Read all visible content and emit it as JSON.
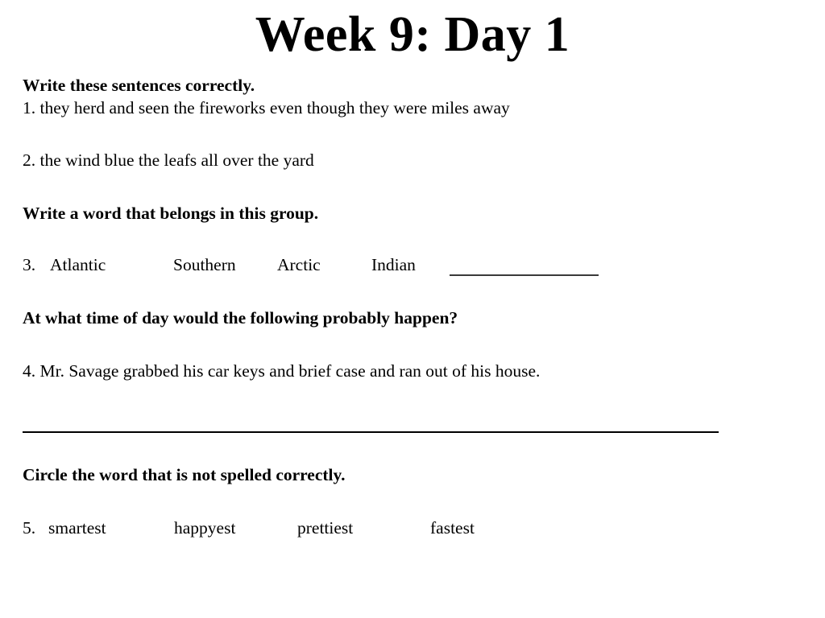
{
  "document": {
    "title": "Week 9: Day 1"
  },
  "sections": [
    {
      "heading": "Write these sentences correctly.",
      "items": [
        {
          "number": "1.",
          "text": "they herd and seen the fireworks even though they were miles away"
        },
        {
          "number": "2.",
          "text": "the wind blue the leafs all over the yard"
        }
      ]
    },
    {
      "heading": "Write a word that belongs in this group.",
      "items": [
        {
          "number": "3.",
          "words": [
            "Atlantic",
            "Southern",
            "Arctic",
            "Indian"
          ],
          "blank": "______________"
        }
      ]
    },
    {
      "heading": "At what time of day would the following probably happen?",
      "items": [
        {
          "number": "4.",
          "text": "Mr. Savage grabbed his car keys and brief case and ran out of his house."
        }
      ]
    },
    {
      "heading": "Circle the word that is not spelled correctly.",
      "items": [
        {
          "number": "5.",
          "words": [
            "smartest",
            "happyest",
            "prettiest",
            "fastest"
          ]
        }
      ]
    }
  ],
  "colors": {
    "text": "#000000",
    "rule": "#000000",
    "blank_rule": "#3a3a3a",
    "background": "#ffffff"
  }
}
